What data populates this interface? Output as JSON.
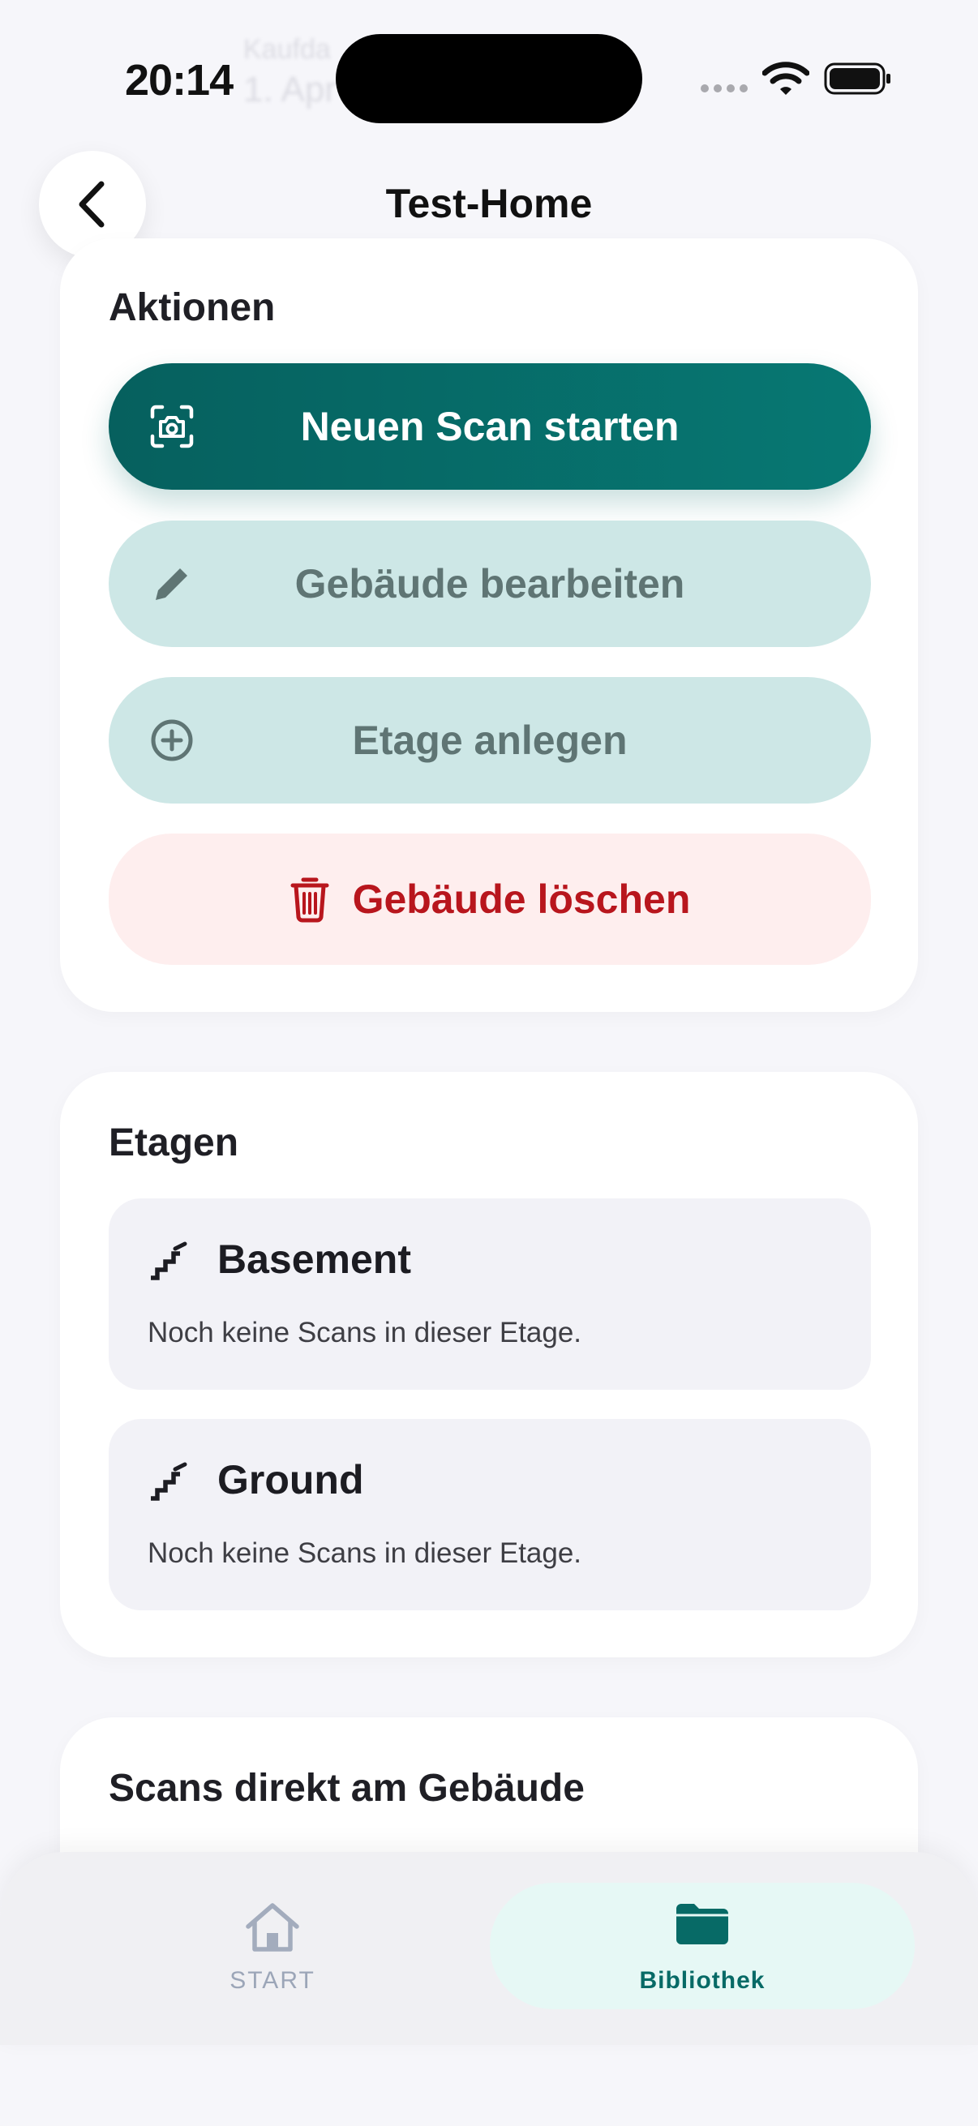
{
  "status_bar": {
    "time": "20:14"
  },
  "background_ghost": {
    "line1": "Kaufda",
    "line2": "1. Apr"
  },
  "header": {
    "title": "Test-Home",
    "back_icon": "chevron-left-icon"
  },
  "actions_card": {
    "title": "Aktionen",
    "buttons": [
      {
        "label": "Neuen Scan starten",
        "icon": "camera-scan-icon"
      },
      {
        "label": "Gebäude bearbeiten",
        "icon": "pencil-icon"
      },
      {
        "label": "Etage anlegen",
        "icon": "plus-circle-icon"
      },
      {
        "label": "Gebäude löschen",
        "icon": "trash-icon"
      }
    ]
  },
  "floors_card": {
    "title": "Etagen",
    "floors": [
      {
        "name": "Basement",
        "description": "Noch keine Scans in dieser Etage.",
        "icon": "stairs-icon"
      },
      {
        "name": "Ground",
        "description": "Noch keine Scans in dieser Etage.",
        "icon": "stairs-icon"
      }
    ]
  },
  "scans_card": {
    "title": "Scans direkt am Gebäude"
  },
  "tab_bar": {
    "tabs": [
      {
        "label": "START",
        "icon": "house-icon",
        "active": false
      },
      {
        "label": "Bibliothek",
        "icon": "folder-icon",
        "active": true
      }
    ]
  },
  "colors": {
    "primary": "#077873",
    "primary_soft": "#cde7e6",
    "danger": "#b8161d",
    "danger_soft": "#feeeee",
    "tab_active_bg": "#e6f8f5",
    "tab_inactive": "#9ca6b8"
  }
}
